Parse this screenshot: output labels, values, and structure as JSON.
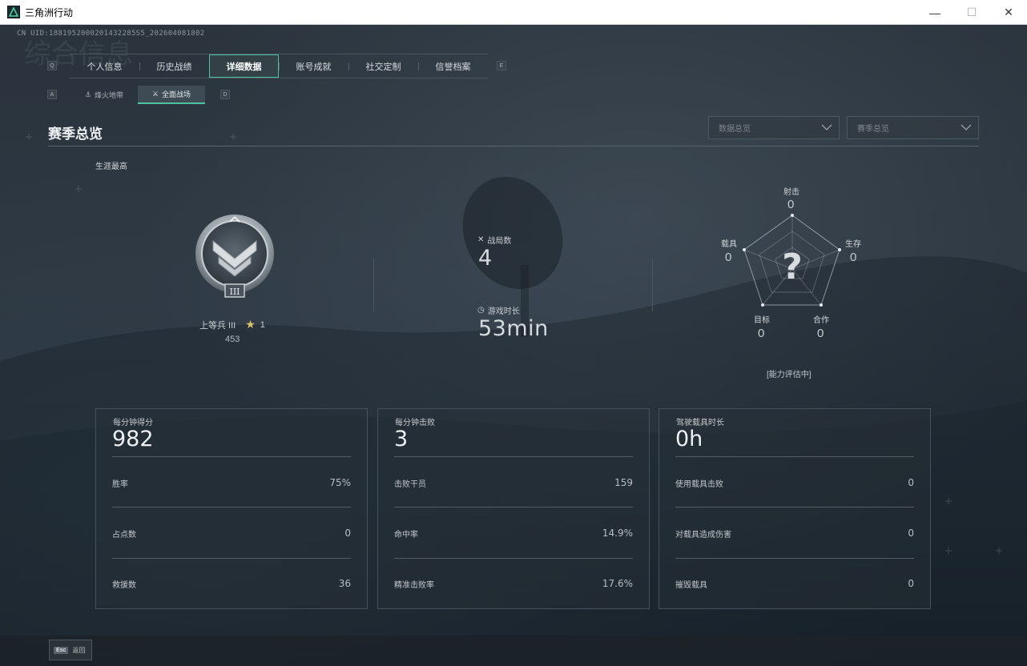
{
  "window": {
    "title": "三角洲行动",
    "minimize": "—",
    "maximize": "☐",
    "close": "✕"
  },
  "uid": "CN UID:1881952000201432285S5_202604081802",
  "tabs": {
    "prev_key": "Q",
    "next_key": "E",
    "items": [
      "个人信息",
      "历史战绩",
      "详细数据",
      "账号成就",
      "社交定制",
      "信誉档案"
    ],
    "active_index": 2
  },
  "subtabs": {
    "prev_key": "A",
    "next_key": "D",
    "items": [
      "烽火地带",
      "全面战场"
    ],
    "active_index": 1
  },
  "section": {
    "title": "赛季总览",
    "dropdown1": "数据总览",
    "dropdown2": "赛季总览"
  },
  "career": {
    "label": "生涯最高",
    "rank_name": "上等兵 III",
    "stars": "1",
    "points": "453",
    "badge_numeral": "III"
  },
  "summary": {
    "matches_label": "战局数",
    "matches_value": "4",
    "playtime_label": "游戏时长",
    "playtime_value": "53min"
  },
  "radar": {
    "shooting_label": "射击",
    "shooting_value": "0",
    "survival_label": "生存",
    "survival_value": "0",
    "teamwork_label": "合作",
    "teamwork_value": "0",
    "objective_label": "目标",
    "objective_value": "0",
    "vehicle_label": "载具",
    "vehicle_value": "0",
    "center_symbol": "?",
    "status": "[能力评估中]"
  },
  "cards": [
    {
      "head": "每分钟得分",
      "big": "982",
      "rows": [
        {
          "label": "胜率",
          "value": "75%"
        },
        {
          "label": "占点数",
          "value": "0"
        },
        {
          "label": "救援数",
          "value": "36"
        }
      ]
    },
    {
      "head": "每分钟击败",
      "big": "3",
      "rows": [
        {
          "label": "击败干员",
          "value": "159"
        },
        {
          "label": "命中率",
          "value": "14.9%"
        },
        {
          "label": "精准击败率",
          "value": "17.6%"
        }
      ]
    },
    {
      "head": "驾驶载具时长",
      "big": "0h",
      "rows": [
        {
          "label": "使用载具击败",
          "value": "0"
        },
        {
          "label": "对载具造成伤害",
          "value": "0"
        },
        {
          "label": "摧毁载具",
          "value": "0"
        }
      ]
    }
  ],
  "bottom": {
    "esc_key": "Esc",
    "esc_label": "返回"
  },
  "colors": {
    "accent": "#4fc3a1",
    "background": "#2a323b"
  }
}
